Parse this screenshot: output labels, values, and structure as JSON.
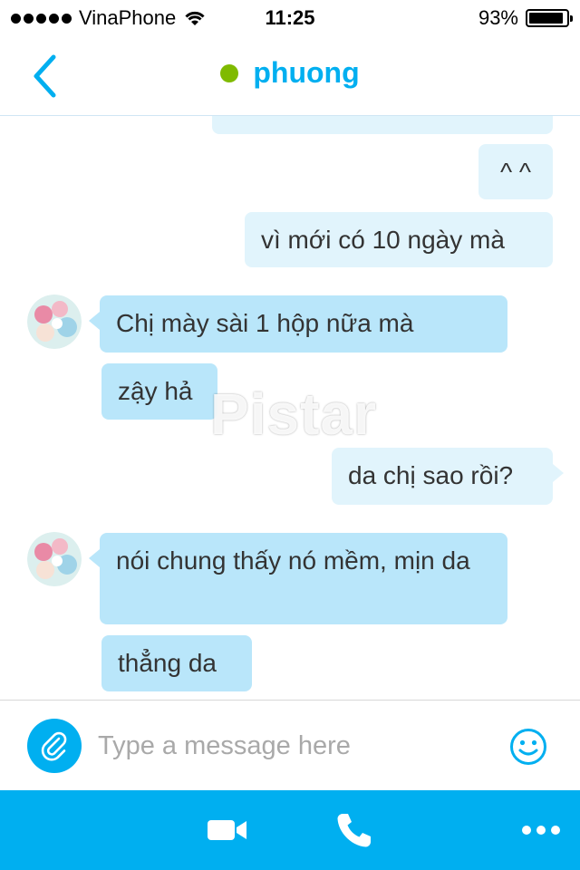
{
  "status_bar": {
    "carrier": "VinaPhone",
    "time": "11:25",
    "battery": "93%",
    "battery_level": 0.93,
    "signal_bars": 5
  },
  "header": {
    "contact_name": "phuong",
    "presence_color": "#7fba00",
    "back_icon": "chevron-left-icon"
  },
  "messages": [
    {
      "direction": "outgoing",
      "text": ""
    },
    {
      "direction": "outgoing",
      "text": "^ ^"
    },
    {
      "direction": "outgoing",
      "text": "vì mới có 10 ngày mà"
    },
    {
      "direction": "incoming",
      "text": "Chị mày sài 1 hộp nữa mà"
    },
    {
      "direction": "incoming",
      "text": "zậy hả"
    },
    {
      "direction": "outgoing",
      "text": "da chị sao rồi?"
    },
    {
      "direction": "incoming",
      "text": "nói chung thấy nó mềm, mịn da"
    },
    {
      "direction": "incoming",
      "text": "thẳng da"
    }
  ],
  "watermark": "Pistar",
  "composer": {
    "placeholder": "Type a message here",
    "value": "",
    "attach_icon": "paperclip-icon",
    "emoji_icon": "smiley-icon"
  },
  "toolbar": {
    "items": [
      "video-call-icon",
      "phone-icon",
      "more-icon"
    ]
  },
  "colors": {
    "accent": "#00aff0",
    "incoming_bubble": "#b9e6fa",
    "outgoing_bubble": "#e1f4fc"
  }
}
